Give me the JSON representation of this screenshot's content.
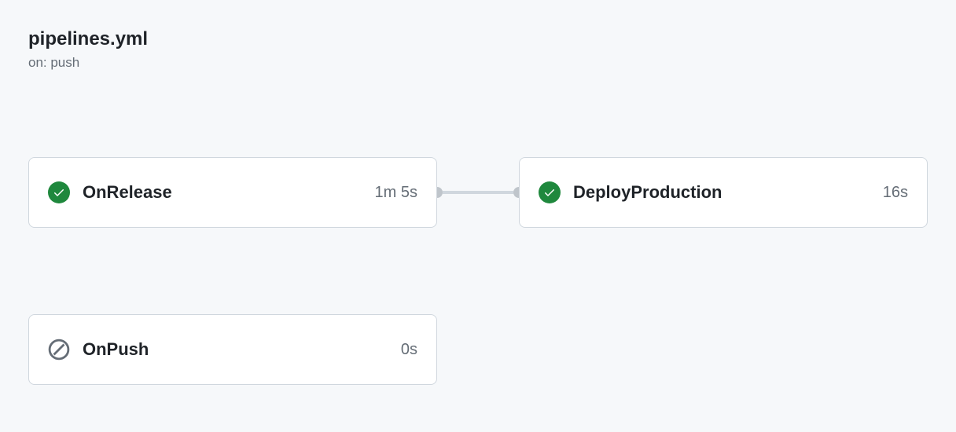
{
  "header": {
    "title": "pipelines.yml",
    "trigger": "on: push"
  },
  "rows": [
    {
      "jobs": [
        {
          "name": "OnRelease",
          "duration": "1m 5s",
          "status": "success"
        },
        {
          "name": "DeployProduction",
          "duration": "16s",
          "status": "success"
        }
      ]
    },
    {
      "jobs": [
        {
          "name": "OnPush",
          "duration": "0s",
          "status": "skipped"
        }
      ]
    }
  ]
}
